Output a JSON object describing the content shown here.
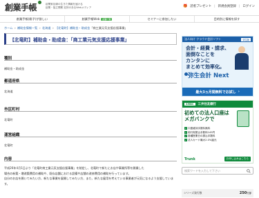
{
  "header": {
    "logo": "創業手帳",
    "tagline_line1": "起業家目線の生きた情報を届ける",
    "tagline_line2": "起業・独立開業 定評のあるWebメディア",
    "links": [
      {
        "label": "読者プレゼント",
        "icon": "gift-icon"
      },
      {
        "label": "新規会員登録"
      },
      {
        "label": "ログイン"
      }
    ]
  },
  "nav": {
    "items": [
      {
        "label": "創業手帳(冊子)が欲しい"
      },
      {
        "label": "創業手帳Web",
        "badge": "記事一覧"
      },
      {
        "label": "セミナーに参加したい"
      },
      {
        "label": "目的別に情報を探す"
      }
    ]
  },
  "breadcrumb": [
    "ホーム",
    "補助金情報一覧",
    "北海道",
    "【北竜町】補助金・助成金"
  ],
  "breadcrumb_current": "「商工業元気支援応援事業」",
  "main": {
    "title": "【北竜町】補助金・助成金：「商工業元気支援応援事業」",
    "sections": [
      {
        "heading": "種別",
        "value": "補助金・助成金"
      },
      {
        "heading": "都道府県",
        "value": "北海道"
      },
      {
        "heading": "市区町村",
        "value": "北竜町"
      },
      {
        "heading": "運営組織",
        "value": "北竜町"
      },
      {
        "heading": "内容",
        "value": ""
      }
    ],
    "content_lines": [
      "平成26年4月1日より「北竜町商工業元気支援応援事業」を制定し、北竜町で新たにお店や事業所等を開業した",
      "場合の新築・増改築費用の補助や、既存店舗における設備や店舗の改修費用の補助を行っています。",
      "自分のお店を開いてみたい方、新たな事業を展開してみたい方、また、新たな雇用を考えている事業者が元気になるよう支援しています。"
    ]
  },
  "sidebar": {
    "ad1": {
      "header": "法人向け クラウド会計ソフト",
      "badge": "弥生版",
      "copy_line1": "会計・経費・請求、",
      "copy_line2": "面倒なことを",
      "copy_line3": "カンタンに",
      "copy_line4": "まとめて効率化。",
      "brand": "弥生会計 Next",
      "cta": "最大3ヵ月間無料でお試し"
    },
    "ad2": {
      "logo": "SMBC",
      "name": "三井住友銀行",
      "copy_line1": "初めての法人口座は",
      "copy_line2": "メガバンクで",
      "items": [
        "口座維持手数料無料",
        "他行宛振込手数料145円",
        "各種営業日の振込手数料",
        "法人カード最大2.0%還元"
      ],
      "brand": "Trunk",
      "cta": "お申し込みはこちら"
    },
    "search": {
      "placeholder": "検索ワードを入力して下さい"
    },
    "series": {
      "label": "シリーズ発行数",
      "count": "250",
      "unit": "万部"
    }
  }
}
